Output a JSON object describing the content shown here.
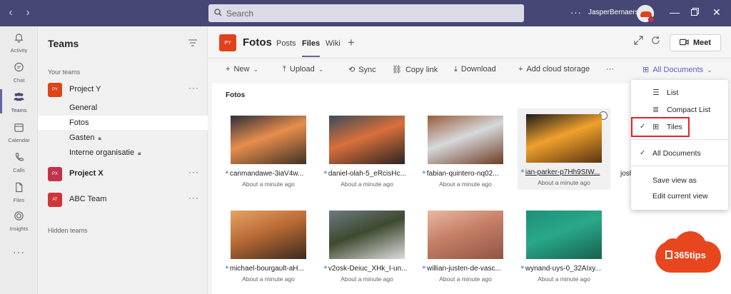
{
  "window": {
    "search_placeholder": "Search",
    "more": "···",
    "user_name": "JasperBernaers"
  },
  "rail": [
    {
      "label": "Activity",
      "icon": "bell-icon"
    },
    {
      "label": "Chat",
      "icon": "chat-icon"
    },
    {
      "label": "Teams",
      "icon": "teams-icon",
      "active": true
    },
    {
      "label": "Calendar",
      "icon": "calendar-icon"
    },
    {
      "label": "Calls",
      "icon": "phone-icon"
    },
    {
      "label": "Files",
      "icon": "file-icon"
    },
    {
      "label": "Insights",
      "icon": "insights-icon"
    }
  ],
  "rail_more": "···",
  "teams_panel": {
    "title": "Teams",
    "your_teams": "Your teams",
    "hidden_teams": "Hidden teams",
    "teams": [
      {
        "initials": "PY",
        "name": "Project Y",
        "color": "#e0431a",
        "bold": false
      },
      {
        "initials": "PX",
        "name": "Project X",
        "color": "#c4314b",
        "bold": true
      },
      {
        "initials": "AT",
        "name": "ABC Team",
        "color": "#d13438",
        "bold": false
      }
    ],
    "channels": [
      {
        "name": "General",
        "locked": false,
        "active": false
      },
      {
        "name": "Fotos",
        "locked": false,
        "active": true
      },
      {
        "name": "Gasten",
        "locked": true,
        "active": false
      },
      {
        "name": "Interne organisatie",
        "locked": true,
        "active": false
      }
    ]
  },
  "channel": {
    "initials": "PY",
    "title": "Fotos",
    "tabs": [
      "Posts",
      "Files",
      "Wiki"
    ],
    "active_tab": "Files",
    "meet_label": "Meet"
  },
  "commands": {
    "new": "New",
    "upload": "Upload",
    "sync": "Sync",
    "copy_link": "Copy link",
    "download": "Download",
    "add_cloud": "Add cloud storage",
    "more": "···",
    "view": "All Documents"
  },
  "library": {
    "title": "Fotos",
    "files": [
      {
        "name": "canmandawe-3iaV4w...",
        "date": "About a minute ago",
        "colors": [
          "#2b2f3a",
          "#e98d4d",
          "#3d3323"
        ]
      },
      {
        "name": "daniel-olah-5_eRcisHc...",
        "date": "About a minute ago",
        "colors": [
          "#3b4a5a",
          "#d9703a",
          "#2a2523"
        ]
      },
      {
        "name": "fabian-quintero-nq02...",
        "date": "About a minute ago",
        "colors": [
          "#9a5b3a",
          "#d6d9db",
          "#6e3b24"
        ]
      },
      {
        "name": "ian-parker-p7Hh9SIW...",
        "date": "About a minute ago",
        "colors": [
          "#1b1b1b",
          "#f0a12c",
          "#5a3310"
        ]
      },
      {
        "name": "michael-bourgault-aH...",
        "date": "About a minute ago",
        "colors": [
          "#e6a465",
          "#b86a34",
          "#3b2a20"
        ]
      },
      {
        "name": "v2osk-Deiuc_XHk_I-un...",
        "date": "About a minute ago",
        "colors": [
          "#6e7a82",
          "#3e4a2e",
          "#dcdcdc"
        ]
      },
      {
        "name": "willian-justen-de-vasc...",
        "date": "About a minute ago",
        "colors": [
          "#e7b9a3",
          "#c67e66",
          "#8f5544"
        ]
      },
      {
        "name": "wynand-uys-0_32AIxy...",
        "date": "About a minute ago",
        "colors": [
          "#1f8f77",
          "#2aa88a",
          "#16614f"
        ]
      }
    ],
    "partial_name": "josh"
  },
  "view_menu": {
    "list": "List",
    "compact_list": "Compact List",
    "tiles": "Tiles",
    "all_documents": "All Documents",
    "save_view_as": "Save view as",
    "edit_current_view": "Edit current view",
    "check": "✓"
  },
  "badge": {
    "text": "365tips"
  }
}
